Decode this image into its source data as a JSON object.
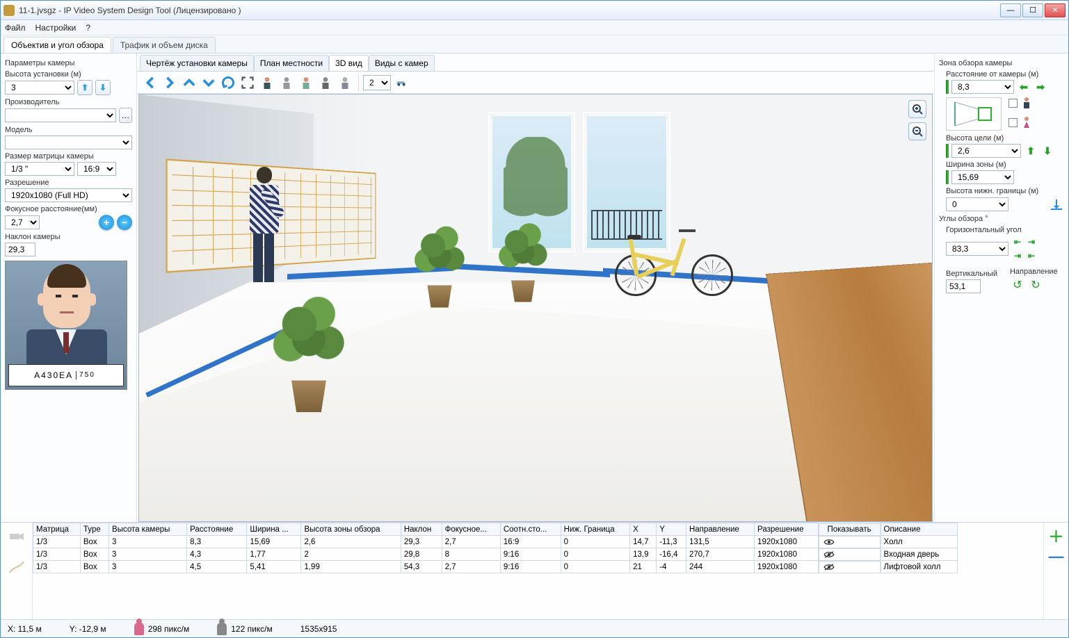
{
  "title": "11-1.jvsgz - IP Video System Design Tool (Лицензировано                            )",
  "menu": {
    "file": "Файл",
    "settings": "Настройки",
    "help": "?"
  },
  "topTabs": {
    "lens": "Объектив и угол обзора",
    "traffic": "Трафик и объем диска"
  },
  "left": {
    "params": "Параметры камеры",
    "heightLabel": "Высота установки (м)",
    "height": "3",
    "manufacturer": "Производитель",
    "model": "Модель",
    "sensorLabel": "Размер матрицы камеры",
    "sensor": "1/3 \"",
    "aspect": "16:9",
    "resolutionLabel": "Разрешение",
    "resolution": "1920x1080 (Full HD)",
    "focalLabel": "Фокусное расстояние(мм)",
    "focal": "2,7",
    "tiltLabel": "Наклон камеры",
    "tilt": "29,3",
    "plate": "A430EA",
    "plateRegion": "750"
  },
  "subTabs": {
    "drawing": "Чертёж установки камеры",
    "plan": "План местности",
    "view3d": "3D вид",
    "camviews": "Виды с камер"
  },
  "toolbar": {
    "floor": "2"
  },
  "right": {
    "zone": "Зона обзора камеры",
    "distLabel": "Расстояние от камеры (м)",
    "dist": "8,3",
    "targetHLabel": "Высота цели (м)",
    "targetH": "2,6",
    "zoneWLabel": "Ширина зоны (м)",
    "zoneW": "15,69",
    "lowerLabel": "Высота нижн. границы (м)",
    "lower": "0",
    "angles": "Углы обзора °",
    "horizLabel": "Горизонтальный угол",
    "horiz": "83,3",
    "vertLabel": "Вертикальный",
    "vert": "53,1",
    "dirLabel": "Направление"
  },
  "table": {
    "headers": [
      "Матрица",
      "Type",
      "Высота камеры",
      "Расстояние",
      "Ширина ...",
      "Высота зоны обзора",
      "Наклон",
      "Фокусное...",
      "Соотн.сто...",
      "Ниж. Граница",
      "X",
      "Y",
      "Направление",
      "Разрешение",
      "Показывать",
      "Описание"
    ],
    "rows": [
      [
        "1/3",
        "Box",
        "3",
        "8,3",
        "15,69",
        "2,6",
        "29,3",
        "2,7",
        "16:9",
        "0",
        "14,7",
        "-11,3",
        "131,5",
        "1920x1080",
        "on",
        "Холл"
      ],
      [
        "1/3",
        "Box",
        "3",
        "4,3",
        "1,77",
        "2",
        "29,8",
        "8",
        "9:16",
        "0",
        "13,9",
        "-16,4",
        "270,7",
        "1920x1080",
        "off",
        "Входная дверь"
      ],
      [
        "1/3",
        "Box",
        "3",
        "4,5",
        "5,41",
        "1,99",
        "54,3",
        "2,7",
        "9:16",
        "0",
        "21",
        "-4",
        "244",
        "1920x1080",
        "off",
        "Лифтовой холл"
      ]
    ]
  },
  "status": {
    "x": "X: 11,5 м",
    "y": "Y: -12,9 м",
    "px1": "298 пикс/м",
    "px2": "122 пикс/м",
    "res": "1535x915"
  }
}
